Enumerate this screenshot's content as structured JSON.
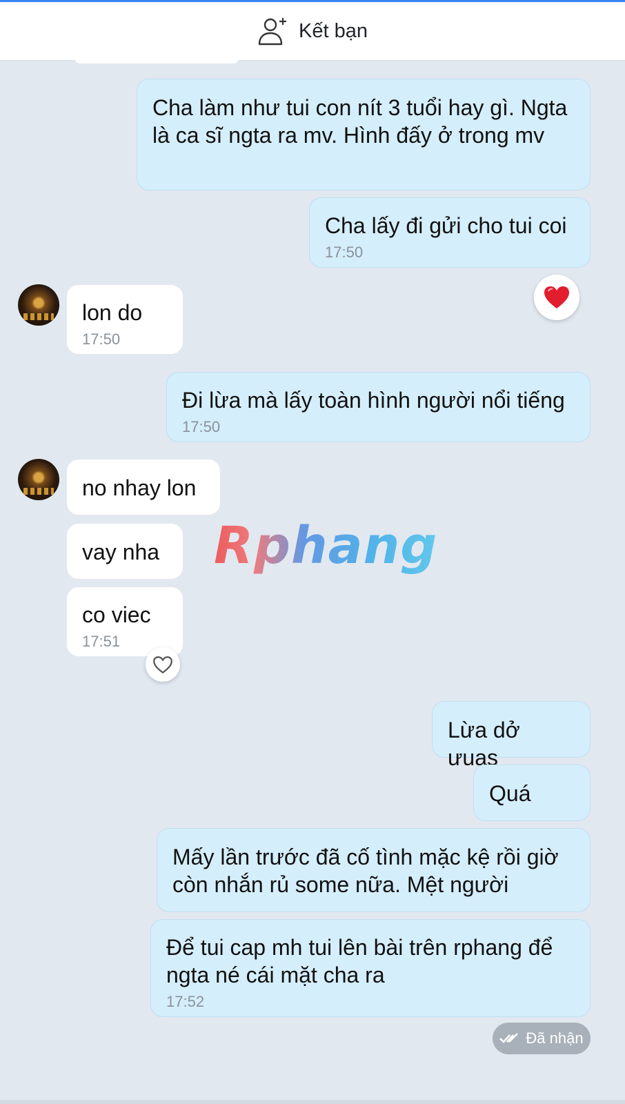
{
  "header": {
    "add_friend_label": "Kết bạn"
  },
  "messages": [
    {
      "text": "Cha làm như tui con nít 3 tuổi hay gì. Ngta là ca sĩ ngta ra mv. Hình đấy ở trong mv"
    },
    {
      "text": "Cha lấy đi gửi cho tui coi",
      "time": "17:50"
    },
    {
      "text": "lon do",
      "time": "17:50"
    },
    {
      "text": "Đi lừa mà lấy toàn hình người nổi tiếng",
      "time": "17:50"
    },
    {
      "text": "no nhay lon"
    },
    {
      "text": "vay nha"
    },
    {
      "text": "co viec",
      "time": "17:51"
    },
    {
      "text": "Lừa dở ưuas"
    },
    {
      "text": "Quá"
    },
    {
      "text": "Mấy lần trước đã cố tình mặc kệ rồi giờ còn nhắn rủ some nữa. Mệt người"
    },
    {
      "text": "Để tui cap mh tui lên bài trên rphang để ngta né cái mặt cha ra",
      "time": "17:52"
    }
  ],
  "reactions": {
    "heart_filled": "heart-icon",
    "heart_outline": "heart-outline-icon"
  },
  "watermark": "Rphang",
  "status": {
    "label": "Đã nhận"
  },
  "colors": {
    "sent_bubble": "#d5eefb",
    "received_bubble": "#ffffff",
    "background": "#e2e8f0",
    "accent": "#3b82f6"
  }
}
